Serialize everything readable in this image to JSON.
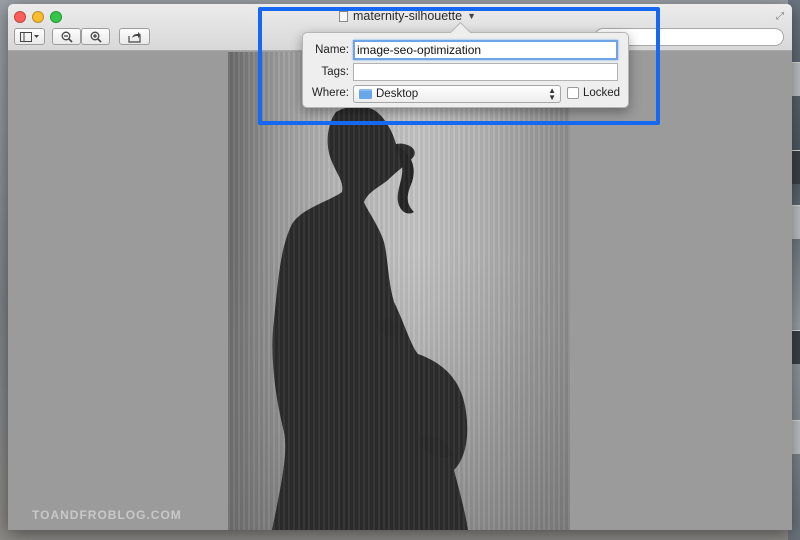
{
  "window": {
    "title": "maternity-silhouette"
  },
  "popover": {
    "name_label": "Name:",
    "name_value": "image-seo-optimization",
    "tags_label": "Tags:",
    "tags_value": "",
    "where_label": "Where:",
    "where_value": "Desktop",
    "locked_label": "Locked",
    "locked_checked": false
  },
  "watermark": "TOANDFROBLOG.COM",
  "colors": {
    "highlight": "#1667f2",
    "focus_ring": "#6ea3e6"
  },
  "icons": [
    "doc-icon",
    "chevron-down-icon",
    "sidebar-toggle-icon",
    "zoom-out-icon",
    "zoom-in-icon",
    "share-icon",
    "folder-icon",
    "fullscreen-icon"
  ]
}
